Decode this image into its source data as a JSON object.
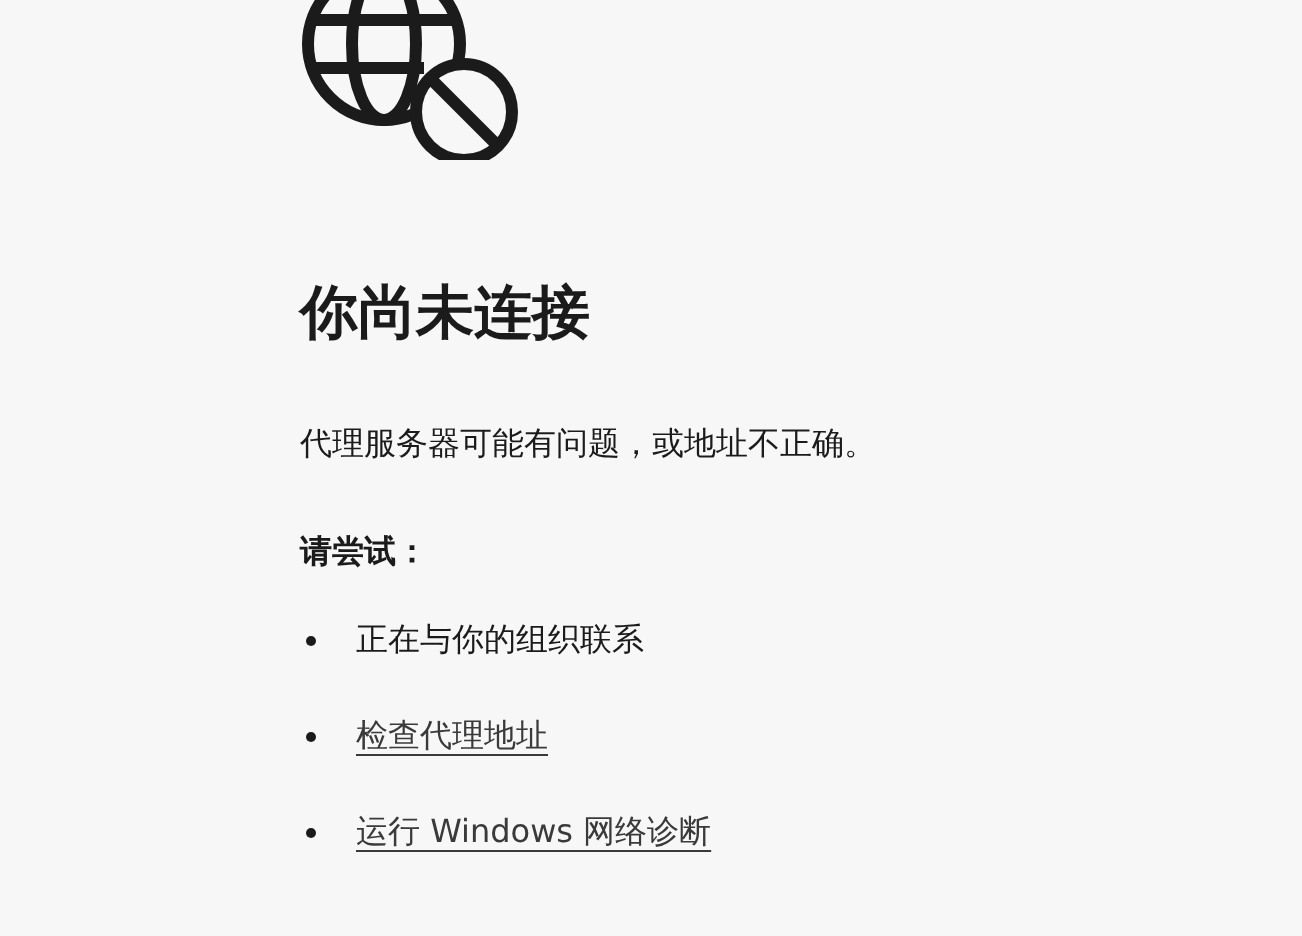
{
  "title": "你尚未连接",
  "message": "代理服务器可能有问题，或地址不正确。",
  "suggestions_heading": "请尝试：",
  "suggestions": [
    {
      "kind": "text",
      "text": "正在与你的组织联系"
    },
    {
      "kind": "link",
      "text": "检查代理地址"
    },
    {
      "kind": "link",
      "text": "运行 Windows 网络诊断"
    }
  ]
}
